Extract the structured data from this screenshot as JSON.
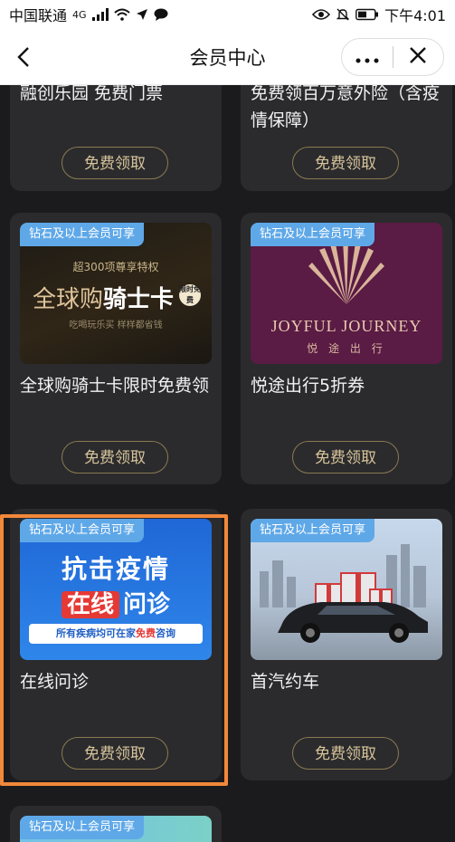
{
  "statusbar": {
    "carrier": "中国联通",
    "network": "4G",
    "time": "下午4:01"
  },
  "navbar": {
    "title": "会员中心",
    "more_label": "•••",
    "close_label": "✕",
    "back_label": "‹"
  },
  "common": {
    "tag": "钻石及以上会员可享",
    "button": "免费领取"
  },
  "cards": [
    {
      "title": "融创乐园 免费门票"
    },
    {
      "title": "免费领百万意外险（含疫情保障）"
    },
    {
      "title": "全球购骑士卡限时免费领",
      "thumb": {
        "headline": "超300项尊享特权",
        "main_prefix": "全球购",
        "main_suffix": "骑士卡",
        "badge": "限时免费",
        "sub": "吃喝玩乐买 样样都省钱"
      }
    },
    {
      "title": "悦途出行5折券",
      "thumb": {
        "brand_en": "JOYFUL JOURNEY",
        "brand_cn": "悦 途 出 行"
      }
    },
    {
      "title": "在线问诊",
      "thumb": {
        "line1": "抗击疫情",
        "line2_a": "在线",
        "line2_b": "问诊",
        "line3_prefix": "所有疾病均可在家",
        "line3_free": "免费",
        "line3_suffix": "咨询"
      }
    },
    {
      "title": "首汽约车"
    },
    {
      "title": ""
    }
  ]
}
